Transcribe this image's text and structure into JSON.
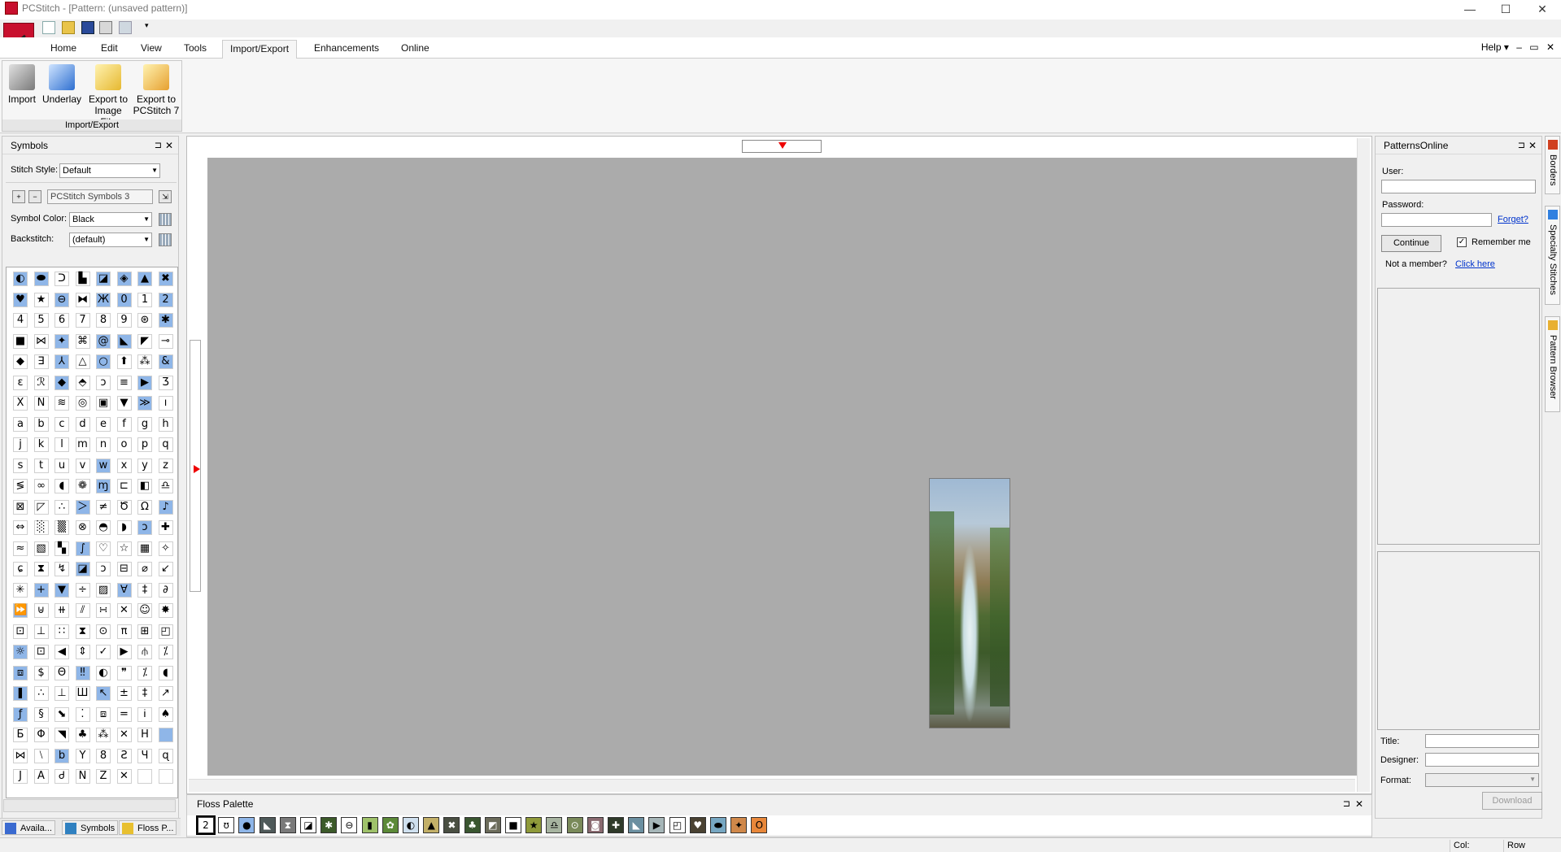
{
  "window": {
    "title": "PCStitch - [Pattern: (unsaved pattern)]"
  },
  "window_controls": {
    "minimize": "—",
    "maximize": "☐",
    "close": "✕"
  },
  "ribbon_tabs": [
    "Home",
    "Edit",
    "View",
    "Tools",
    "Import/Export",
    "Enhancements",
    "Online"
  ],
  "active_tab": "Import/Export",
  "help": {
    "label": "Help ▾",
    "min": "–",
    "restore": "▭",
    "close": "✕"
  },
  "ribbon": {
    "group_label": "Import/Export",
    "buttons": [
      {
        "line1": "Import",
        "line2": ""
      },
      {
        "line1": "Underlay",
        "line2": ""
      },
      {
        "line1": "Export to",
        "line2": "Image File"
      },
      {
        "line1": "Export to",
        "line2": "PCStitch 7"
      }
    ]
  },
  "symbols_pane": {
    "title": "Symbols",
    "pin": "⊐",
    "close": "✕",
    "stitch_style_label": "Stitch Style:",
    "stitch_style_value": "Default",
    "symbol_set_value": "PCStitch Symbols 3",
    "symbol_color_label": "Symbol Color:",
    "symbol_color_value": "Black",
    "backstitch_label": "Backstitch:",
    "backstitch_value": "(default)"
  },
  "symbols": [
    "◐",
    "⬬",
    "ᑐ",
    "▙",
    "◪",
    "◈",
    "▲",
    "✖",
    "♥",
    "★",
    "⊖",
    "⧓",
    "Ж",
    "0",
    "1",
    "2",
    "4",
    "5",
    "6",
    "7",
    "8",
    "9",
    "⊛",
    "✱",
    "■",
    "⋈",
    "✦",
    "⌘",
    "@",
    "◣",
    "◤",
    "⊸",
    "◆",
    "∃",
    "⅄",
    "△",
    "○",
    "⬆",
    "⁂",
    "&",
    "ε",
    "ℛ",
    "◆",
    "⬘",
    "ↄ",
    "≡",
    "▶",
    "Ʒ",
    "X",
    "N",
    "≋",
    "◎",
    "▣",
    "▼",
    "≫",
    "ı",
    "a",
    "b",
    "c",
    "d",
    "e",
    "f",
    "g",
    "h",
    "j",
    "k",
    "l",
    "m",
    "n",
    "o",
    "p",
    "q",
    "s",
    "t",
    "u",
    "v",
    "w",
    "x",
    "y",
    "z",
    "≶",
    "∞",
    "◖",
    "❁",
    "ɱ",
    "⊏",
    "◧",
    "♎",
    "⊠",
    "◸",
    "∴",
    "＞",
    "≠",
    "Ծ",
    "Ω",
    "♪",
    "⇔",
    "░",
    "▒",
    "⊗",
    "◓",
    "◗",
    "ↄ",
    "✚",
    "≈",
    "▧",
    "▚",
    "∫",
    "♡",
    "☆",
    "▦",
    "✧",
    "ɕ",
    "⧗",
    "↯",
    "◪",
    "ↄ",
    "⊟",
    "⌀",
    "↙",
    "✳",
    "+",
    "▼",
    "÷",
    "▨",
    "∀",
    "‡",
    "∂",
    "⏩",
    "⊎",
    "⧺",
    "⫽",
    "∺",
    "✕",
    "☺",
    "✸",
    "⊡",
    "⊥",
    "∷",
    "⧗",
    "⊙",
    "π",
    "⊞",
    "◰",
    "☼",
    "⊡",
    "◀",
    "⇕",
    "✓",
    "▶",
    "⫛",
    "⁒",
    "⧈",
    "$",
    "Θ",
    "‼",
    "◐",
    "❞",
    "⁒",
    "◖",
    "❚",
    "∴",
    "⊥",
    "Ш",
    "↖",
    "±",
    "‡",
    "↗",
    "ƒ",
    "§",
    "⬊",
    "⁚",
    "⧈",
    "=",
    "Ꭵ",
    "♠",
    "Б",
    "Φ",
    "◥",
    "♣",
    "⁂",
    "✕",
    "H",
    "",
    "⋈",
    "⧵",
    "b",
    "Y",
    "8",
    "Ƨ",
    "Ч",
    "ɋ",
    "J",
    "A",
    "Ꮷ",
    "N",
    "Z",
    "✕",
    "",
    ""
  ],
  "symbol_highlights": [
    0,
    1,
    4,
    5,
    6,
    7,
    8,
    10,
    12,
    13,
    15,
    23,
    26,
    28,
    29,
    34,
    36,
    39,
    42,
    46,
    54,
    76,
    84,
    91,
    95,
    102,
    107,
    115,
    121,
    122,
    125,
    128,
    144,
    152,
    155,
    160,
    164,
    168,
    183,
    186
  ],
  "floss_pane": {
    "title": "Floss Palette",
    "pin": "⊐",
    "close": "✕"
  },
  "floss": [
    {
      "sym": "2",
      "color": "#ffffff"
    },
    {
      "sym": "ʊ",
      "color": "#ffffff"
    },
    {
      "sym": "●",
      "color": "#8fb6e8"
    },
    {
      "sym": "◣",
      "color": "#4f5a5a"
    },
    {
      "sym": "⧗",
      "color": "#7a7a7a"
    },
    {
      "sym": "◪",
      "color": "#ffffff"
    },
    {
      "sym": "✱",
      "color": "#3c5a2a"
    },
    {
      "sym": "⊖",
      "color": "#ffffff"
    },
    {
      "sym": "▮",
      "color": "#9fc26a"
    },
    {
      "sym": "✿",
      "color": "#5c8a38"
    },
    {
      "sym": "◐",
      "color": "#cfe0ef"
    },
    {
      "sym": "▲",
      "color": "#c3b068"
    },
    {
      "sym": "✖",
      "color": "#4a4f42"
    },
    {
      "sym": "♣",
      "color": "#3a5630"
    },
    {
      "sym": "◩",
      "color": "#6b6b5a"
    },
    {
      "sym": "■",
      "color": "#ffffff"
    },
    {
      "sym": "★",
      "color": "#8f9a3a"
    },
    {
      "sym": "♎",
      "color": "#a7b4a0"
    },
    {
      "sym": "⊙",
      "color": "#7a8a5a"
    },
    {
      "sym": "◙",
      "color": "#8a6a70"
    },
    {
      "sym": "✚",
      "color": "#2f3a2a"
    },
    {
      "sym": "◣",
      "color": "#6b8fa0"
    },
    {
      "sym": "▶",
      "color": "#a6b6b8"
    },
    {
      "sym": "◰",
      "color": "#ffffff"
    },
    {
      "sym": "♥",
      "color": "#4a4232"
    },
    {
      "sym": "⬬",
      "color": "#77a7c2"
    },
    {
      "sym": "✦",
      "color": "#d0884a"
    },
    {
      "sym": "O",
      "color": "#e8873a"
    }
  ],
  "left_tabs": [
    "Availa...",
    "Symbols",
    "Floss P..."
  ],
  "online_pane": {
    "title": "PatternsOnline",
    "pin": "⊐",
    "close": "✕",
    "user_label": "User:",
    "password_label": "Password:",
    "forget_link": "Forget?",
    "continue_label": "Continue",
    "remember_check": "✓",
    "remember_label": "Remember me",
    "not_member": "Not a member?",
    "click_here": "Click here",
    "title_label": "Title:",
    "designer_label": "Designer:",
    "format_label": "Format:",
    "download_label": "Download"
  },
  "side_tabs": [
    "Borders",
    "Specialty Stitches",
    "Pattern Browser"
  ],
  "status": {
    "col": "Col:",
    "row": "Row"
  },
  "colors": {
    "accent": "#c8102e",
    "canvas": "#ababab",
    "highlight": "#8fb6e8",
    "link": "#0033cc"
  }
}
